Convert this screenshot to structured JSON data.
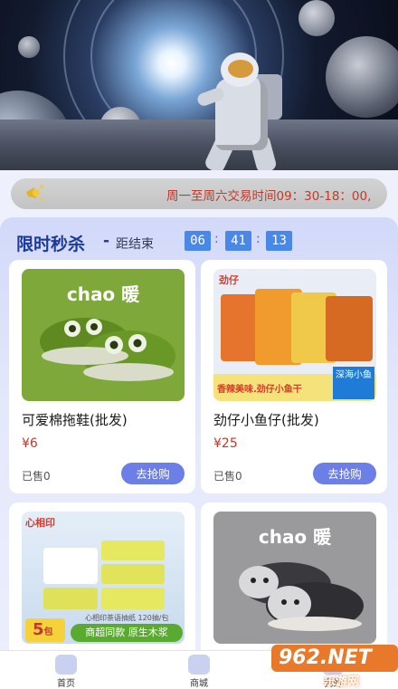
{
  "notice": {
    "text": "周一至周六交易时间09：30-18：00,"
  },
  "flash_sale": {
    "title": "限时秒杀",
    "dash": "-",
    "subtitle": "距结束",
    "countdown": {
      "hours": "06",
      "minutes": "41",
      "seconds": "13",
      "sep": ":"
    }
  },
  "products": [
    {
      "name": "可爱棉拖鞋(批发)",
      "price": "¥6",
      "sold": "已售0",
      "button": "去抢购",
      "image_text": "chao 暖"
    },
    {
      "name": "劲仔小鱼仔(批发)",
      "price": "¥25",
      "sold": "已售0",
      "button": "去抢购",
      "image_text": "劲仔",
      "image_slogan": "香辣美味.劲仔小鱼干",
      "image_side": "深海小鱼"
    },
    {
      "name": "",
      "image_brand": "心相印",
      "image_count": "5",
      "image_count_unit": "包",
      "image_slogan": "商超同款 原生木浆",
      "image_note": "心相印茶语抽纸 120抽/包"
    },
    {
      "name": "",
      "image_text": "chao 暖"
    }
  ],
  "nav": {
    "items": [
      {
        "label": "首页"
      },
      {
        "label": "商城"
      },
      {
        "label": "我的"
      }
    ]
  },
  "watermark": {
    "text": "962.NET",
    "sub": "乐游网"
  },
  "colors": {
    "accent": "#4a88e8",
    "price": "#c0392b",
    "button": "#6b7fe6",
    "title": "#1b3a9a"
  }
}
